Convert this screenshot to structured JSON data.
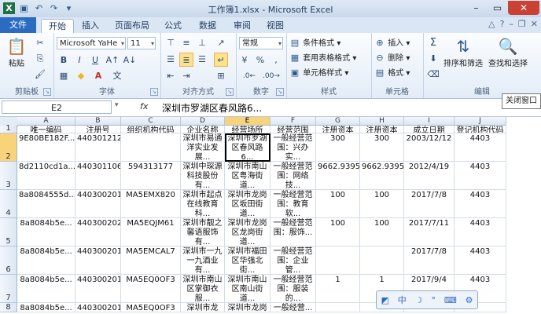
{
  "window": {
    "title": "工作簿1.xlsx - Microsoft Excel"
  },
  "tabs": [
    "文件",
    "开始",
    "插入",
    "页面布局",
    "公式",
    "数据",
    "审阅",
    "视图"
  ],
  "ribbon": {
    "clipboard": {
      "paste": "粘贴",
      "label": "剪贴板"
    },
    "font": {
      "name": "Microsoft YaHe",
      "size": "11",
      "bold": "B",
      "italic": "I",
      "underline": "U",
      "label": "字体"
    },
    "alignment": {
      "label": "对齐方式"
    },
    "number": {
      "format": "常规",
      "percent": "%",
      "comma": ",",
      "label": "数字"
    },
    "styles": {
      "conditional": "条件格式",
      "table": "套用表格格式",
      "cell": "单元格样式",
      "label": "样式"
    },
    "cells": {
      "insert": "插入",
      "delete": "删除",
      "format": "格式",
      "label": "单元格"
    },
    "editing": {
      "sum": "Σ",
      "sort": "排序和筛选",
      "find": "查找和选择",
      "label": "编辑"
    }
  },
  "formula_bar": {
    "name_box": "E2",
    "fx": "fx",
    "content": "深圳市罗湖区春风路6...",
    "close_window": "关闭窗口"
  },
  "columns": [
    "A",
    "B",
    "C",
    "D",
    "E",
    "F",
    "G",
    "H",
    "I",
    "J"
  ],
  "rows": [
    "1",
    "2",
    "3",
    "4",
    "5",
    "6",
    "7",
    "8"
  ],
  "table": {
    "headers": [
      "唯一编码",
      "注册号",
      "组织机构代码",
      "企业名称",
      "经营场所",
      "经营范围",
      "注册资本",
      "注册资本",
      "成立日期",
      "登记机构代码号"
    ],
    "data": [
      [
        "9E80BE182F...",
        "4403012129...",
        "",
        "深圳市易通洋实业发展...",
        "深圳市罗湖区春风路6...",
        "一般经营范围：兴办实...",
        "300",
        "300",
        "2003/12/12",
        "4403"
      ],
      [
        "8d2110cd1a...",
        "4403011061...",
        "594313177",
        "深圳中琛源科技股份有...",
        "深圳市南山区粤海街道...",
        "一般经营范围：网络技...",
        "9662.9395",
        "9662.9395",
        "2012/4/19",
        "4403"
      ],
      [
        "8a8084555d...",
        "4403002018...",
        "MA5EMX820",
        "深圳市起点在线教育科...",
        "深圳市龙岗区坂田街道...",
        "一般经营范围：教育软...",
        "100",
        "100",
        "2017/7/8",
        "4403"
      ],
      [
        "8a8084b5e...",
        "4403002024...",
        "MA5EQJM61",
        "深圳市靓之馨语服饰有...",
        "深圳市龙岗区龙岗街道...",
        "一般经营范围：服饰...",
        "100",
        "100",
        "2017/7/11",
        "4403"
      ],
      [
        "8a8084b5e...",
        "4403002018...",
        "MA5EMCAL7",
        "深圳市一九一九酒业有...",
        "深圳市福田区华强北街...",
        "一般经营范围：企业管...",
        "",
        "",
        "2017/7/8",
        "4403"
      ],
      [
        "8a8084b5e...",
        "4403002018...",
        "MA5EQ0OF3",
        "深圳市南山区掌御衣服...",
        "深圳市南山区南山街道...",
        "一般经营范围：服装的...",
        "1",
        "1",
        "2017/9/4",
        "4403"
      ]
    ],
    "partial_row": [
      "8a8084b5e...",
      "4403002018...",
      "MA5EQ0OF3",
      "深圳市龙岗...",
      "深圳市龙岗区...",
      "一般经营...",
      "",
      "",
      "",
      ""
    ]
  },
  "ime": [
    "中",
    "☽",
    "°",
    "⌨",
    "⚙"
  ]
}
